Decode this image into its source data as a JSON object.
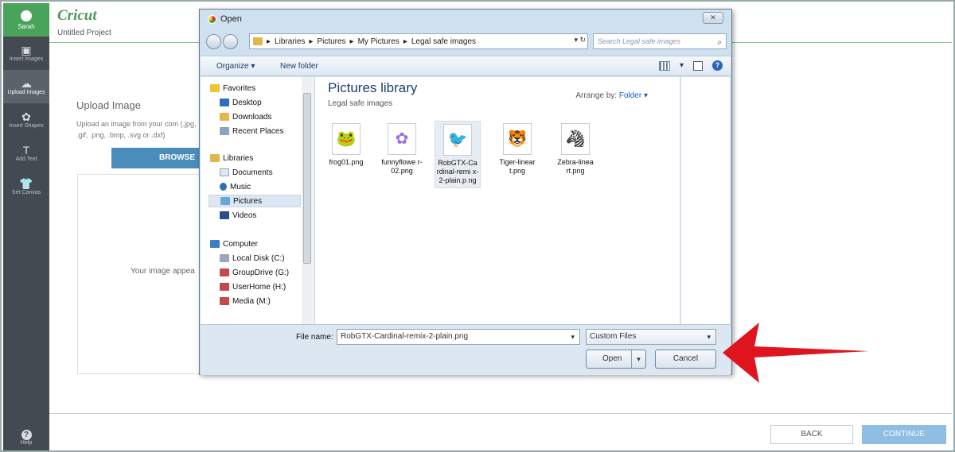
{
  "app": {
    "logo": "Cricut",
    "project_name": "Untitled Project",
    "user": "Sarah"
  },
  "rail": {
    "items": [
      {
        "label": "Insert Images",
        "icon": "image-icon",
        "glyph": "▣"
      },
      {
        "label": "Upload Images",
        "icon": "cloud-upload-icon",
        "glyph": "☁"
      },
      {
        "label": "Insert Shapes",
        "icon": "shapes-icon",
        "glyph": "✿"
      },
      {
        "label": "Add Text",
        "icon": "text-icon",
        "glyph": "T"
      },
      {
        "label": "Set Canvas",
        "icon": "shirt-icon",
        "glyph": "👕"
      }
    ],
    "help_label": "Help",
    "help_glyph": "?"
  },
  "upload": {
    "title": "Upload Image",
    "description": "Upload an image from your com (.jpg, .gif, .png, .bmp, .svg or .dxf)",
    "browse_label": "BROWSE",
    "dropzone_text": "Your image appea"
  },
  "footer": {
    "back_label": "BACK",
    "continue_label": "CONTINUE"
  },
  "dialog": {
    "title": "Open",
    "close_glyph": "✕",
    "breadcrumb": [
      "Libraries",
      "Pictures",
      "My Pictures",
      "Legal safe images"
    ],
    "search_placeholder": "Search Legal safe images",
    "toolbar": {
      "organize": "Organize ▾",
      "new_folder": "New folder"
    },
    "nav": {
      "favorites": "Favorites",
      "desktop": "Desktop",
      "downloads": "Downloads",
      "recent": "Recent Places",
      "libraries": "Libraries",
      "documents": "Documents",
      "music": "Music",
      "pictures": "Pictures",
      "videos": "Videos",
      "computer": "Computer",
      "local_disk": "Local Disk (C:)",
      "group_drive": "GroupDrive (G:)",
      "user_home": "UserHome (H:)",
      "media": "Media (M:)"
    },
    "library_title": "Pictures library",
    "library_subtitle": "Legal safe images",
    "arrange_label": "Arrange by:",
    "arrange_value": "Folder ▾",
    "files": [
      {
        "name": "frog01.png",
        "glyph": "🐸"
      },
      {
        "name": "funnyflowe r-02.png",
        "glyph": "✿"
      },
      {
        "name": "RobGTX-Ca rdinal-remi x-2-plain.p ng",
        "glyph": "🐦"
      },
      {
        "name": "Tiger-linear t.png",
        "glyph": "🐯"
      },
      {
        "name": "Zebra-linea rt.png",
        "glyph": "🦓"
      }
    ],
    "file_name_label": "File name:",
    "file_name_value": "RobGTX-Cardinal-remix-2-plain.png",
    "file_type": "Custom Files",
    "open_label": "Open",
    "cancel_label": "Cancel"
  },
  "colors": {
    "brand_green": "#49a35a",
    "arrow_red": "#e0141e",
    "continue_blue": "#8fbde3"
  }
}
